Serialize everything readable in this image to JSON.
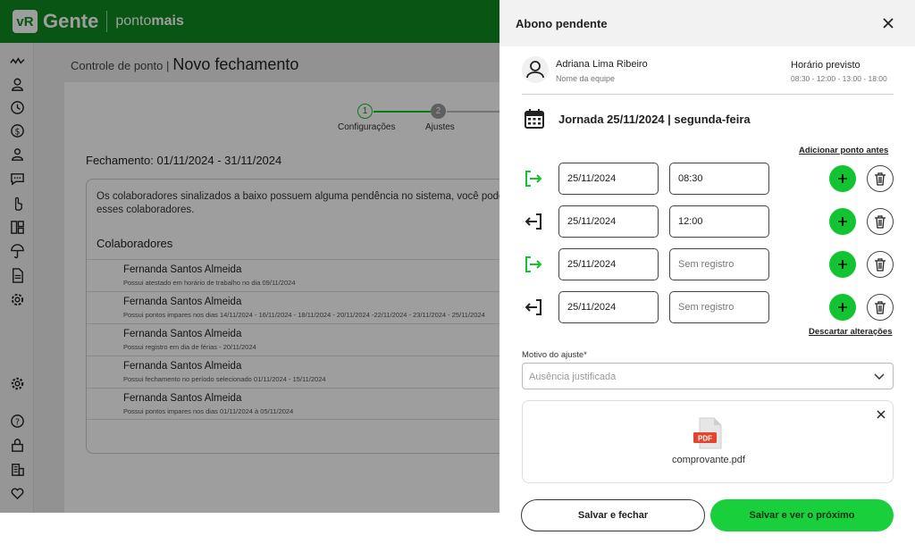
{
  "app": {
    "logo_vr": "vR",
    "logo_gente": "Gente",
    "logo_ponto": "ponto",
    "logo_mais": "mais"
  },
  "sidebar": {
    "icons": [
      "activity-icon",
      "user-icon",
      "clock-icon",
      "money-icon",
      "people-icon",
      "chat-icon",
      "hand-pointer-icon",
      "dashboard-icon",
      "umbrella-icon",
      "document-icon",
      "settings-group-icon",
      "gear-icon",
      "help-icon",
      "lock-icon",
      "building-icon",
      "heart-icon"
    ]
  },
  "page": {
    "breadcrumb_small": "Controle de ponto |",
    "breadcrumb_title": "Novo fechamento",
    "steps": [
      {
        "number": "1",
        "label": "Configurações",
        "state": "active"
      },
      {
        "number": "2",
        "label": "Ajustes",
        "state": "pending"
      }
    ],
    "fechamento_title": "Fechamento: 01/11/2024 - 31/11/2024",
    "collab_intro": "Os colaboradores sinalizados a baixo possuem alguma pendência no sistema, você pode realizar os ajustes ou esses colaboradores.",
    "collab_heading": "Colaboradores",
    "collaborators": [
      {
        "name": "Fernanda Santos Almeida",
        "desc": "Possui atestado em horário de trabalho no dia 09/11/2024"
      },
      {
        "name": "Fernanda Santos Almeida",
        "desc": "Possui pontos impares nos dias 14/11/2024 - 16/11/2024 - 18/11/2024 - 20/11/2024 -22/11/2024 - 23/11/2024 - 25/11/2024"
      },
      {
        "name": "Fernanda Santos Almeida",
        "desc": "Possui registro em dia de férias - 20/11/2024"
      },
      {
        "name": "Fernanda Santos Almeida",
        "desc": "Possui fechamento no período selecionado 01/11/2024 - 15/11/2024"
      },
      {
        "name": "Fernanda Santos Almeida",
        "desc": "Possui pontos impares nos dias 01/11/2024 à 05/11/2024"
      }
    ]
  },
  "drawer": {
    "title": "Abono pendente",
    "user_name": "Adriana Lima Ribeiro",
    "user_team": "Nome da equipe",
    "horario_label": "Horário previsto",
    "horario_value": "08:30 - 12:00 - 13:00 - 18:00",
    "jornada": "Jornada  25/11/2024 | segunda-feira",
    "add_before": "Adicionar ponto antes",
    "punches": [
      {
        "type": "entrada",
        "date": "25/11/2024",
        "time": "08:30",
        "empty": false
      },
      {
        "type": "saida",
        "date": "25/11/2024",
        "time": "12:00",
        "empty": false
      },
      {
        "type": "entrada",
        "date": "25/11/2024",
        "time": "Sem registro",
        "empty": true
      },
      {
        "type": "saida",
        "date": "25/11/2024",
        "time": "Sem registro",
        "empty": true
      }
    ],
    "discard": "Descartar alterações",
    "motivo_label": "Motivo do ajuste*",
    "motivo_value": "Ausência justificada",
    "file_name": "comprovante.pdf",
    "pdf_badge": "PDF",
    "btn_save_close": "Salvar e fechar",
    "btn_save_next": "Salvar e ver o próximo"
  },
  "colors": {
    "brand_green": "#0f8a1f",
    "accent_green": "#12c431",
    "button_green": "#19cf3c"
  }
}
